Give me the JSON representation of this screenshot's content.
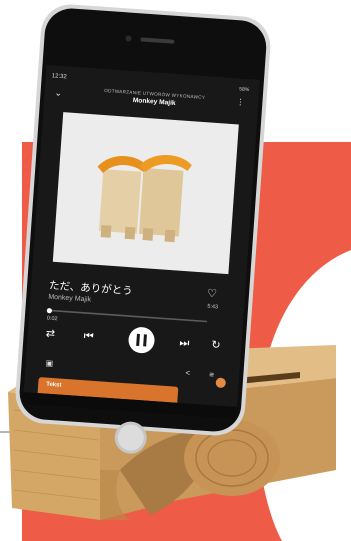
{
  "colors": {
    "coral_panel": "#ee5c47",
    "background": "#ffffff",
    "bamboo": "#d9b07a",
    "bamboo_dark": "#b88a52",
    "phone_screen": "#181818",
    "accent_orange": "#d9742c"
  },
  "status_bar": {
    "time": "12:32",
    "battery": "58%"
  },
  "header": {
    "context": "ODTWARZANIE UTWORÓW WYKONAWCY",
    "title": "Monkey Majik"
  },
  "track": {
    "title": "ただ、ありがとう",
    "artist": "Monkey Majik",
    "elapsed": "0:02",
    "total": "5:43",
    "progress": 0.01
  },
  "lyrics_panel": {
    "label": "Tekst"
  },
  "icons": {
    "back": "chevron-down-icon",
    "menu": "kebab-menu-icon",
    "like": "heart-icon",
    "shuffle": "shuffle-icon",
    "previous": "skip-previous-icon",
    "play_pause": "pause-icon",
    "next": "skip-next-icon",
    "repeat": "repeat-icon",
    "devices": "devices-icon",
    "share": "share-icon",
    "queue": "queue-icon"
  }
}
